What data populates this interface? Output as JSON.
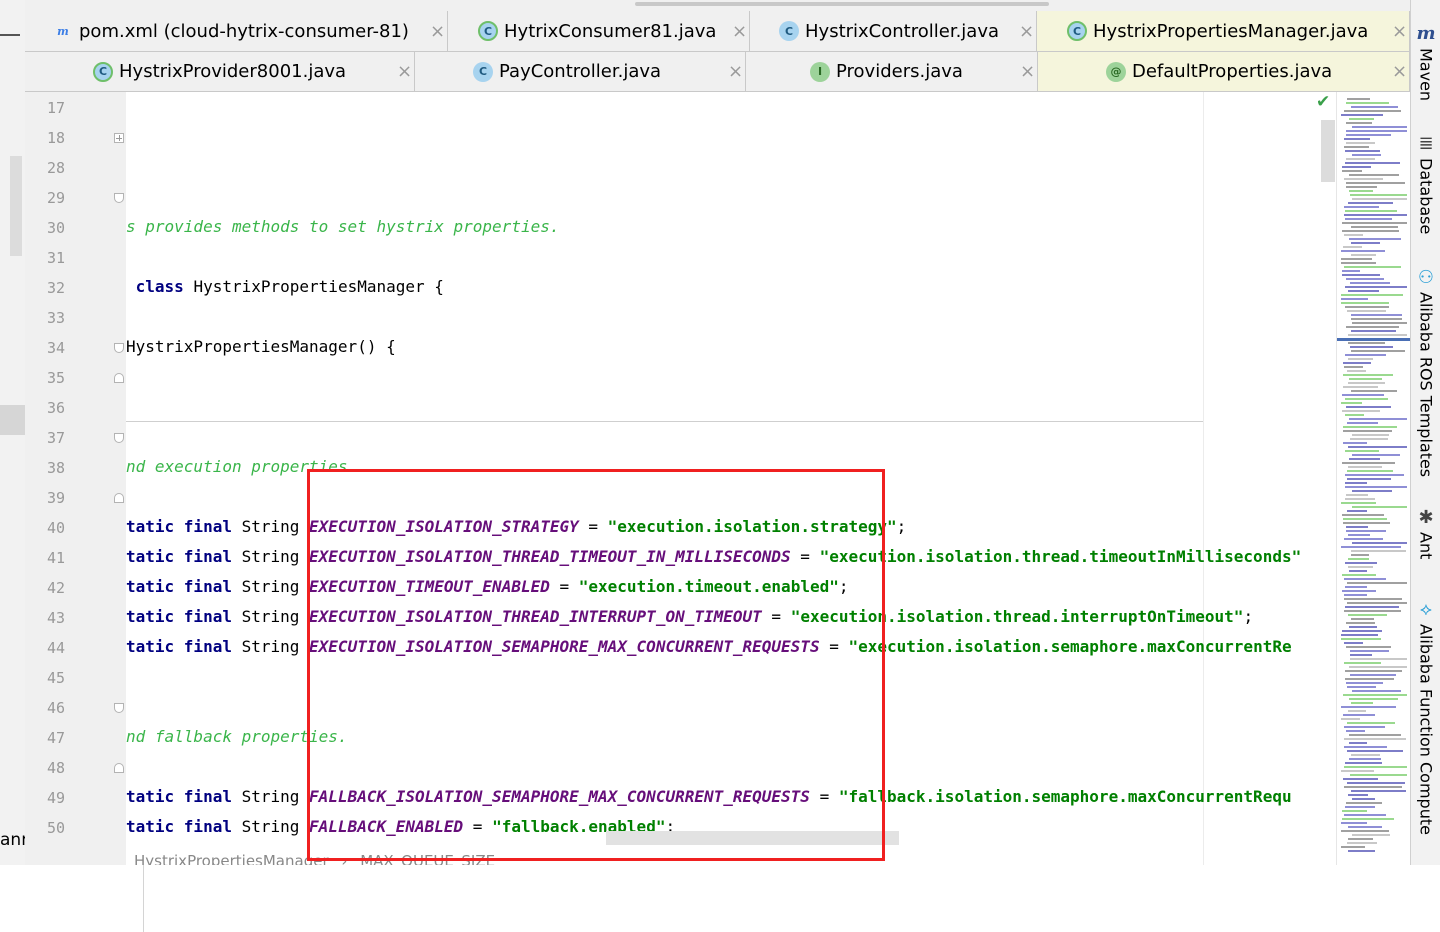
{
  "left_panel": {
    "bottom_text": "anr"
  },
  "tabs_row1": [
    {
      "label": "pom.xml (cloud-hytrix-consumer-81)",
      "icon": "maven-icon",
      "icon_glyph": "m",
      "active": false
    },
    {
      "label": "HytrixConsumer81.java",
      "icon": "spring-class-icon",
      "icon_glyph": "C",
      "active": false
    },
    {
      "label": "HystrixController.java",
      "icon": "class-icon",
      "icon_glyph": "C",
      "active": false
    },
    {
      "label": "HystrixPropertiesManager.java",
      "icon": "spring-class-icon",
      "icon_glyph": "C",
      "active": true
    }
  ],
  "tabs_row2": [
    {
      "label": "HystrixProvider8001.java",
      "icon": "spring-class-icon",
      "icon_glyph": "C",
      "active": false
    },
    {
      "label": "PayController.java",
      "icon": "class-icon",
      "icon_glyph": "C",
      "active": false
    },
    {
      "label": "Providers.java",
      "icon": "interface-icon",
      "icon_glyph": "I",
      "active": false
    },
    {
      "label": "DefaultProperties.java",
      "icon": "annotation-icon",
      "icon_glyph": "@",
      "active": true
    }
  ],
  "close_glyph": "×",
  "line_numbers": [
    "17",
    "18",
    "28",
    "29",
    "30",
    "31",
    "32",
    "33",
    "34",
    "35",
    "36",
    "37",
    "38",
    "39",
    "40",
    "41",
    "42",
    "43",
    "44",
    "45",
    "46",
    "47",
    "48",
    "49",
    "50"
  ],
  "code_lines": [
    {
      "line": "17",
      "tokens": []
    },
    {
      "line": "18",
      "tokens": []
    },
    {
      "line": "28",
      "tokens": []
    },
    {
      "line": "29",
      "tokens": []
    },
    {
      "line": "30",
      "tokens": [
        {
          "t": "s provides methods to set hystrix properties.",
          "c": "comment"
        }
      ]
    },
    {
      "line": "31",
      "tokens": []
    },
    {
      "line": "32",
      "tokens": [
        {
          "t": " ",
          "c": "plain"
        },
        {
          "t": "class",
          "c": "kw"
        },
        {
          "t": " HystrixPropertiesManager {",
          "c": "plain"
        }
      ]
    },
    {
      "line": "33",
      "tokens": []
    },
    {
      "line": "34",
      "tokens": [
        {
          "t": "HystrixPropertiesManager() {",
          "c": "plain"
        }
      ]
    },
    {
      "line": "35",
      "tokens": []
    },
    {
      "line": "36",
      "tokens": []
    },
    {
      "line": "37",
      "tokens": []
    },
    {
      "line": "38",
      "tokens": [
        {
          "t": "nd execution properties.",
          "c": "comment"
        }
      ]
    },
    {
      "line": "39",
      "tokens": []
    },
    {
      "line": "40",
      "tokens": [
        {
          "t": "tatic final",
          "c": "kw"
        },
        {
          "t": " String ",
          "c": "plain"
        },
        {
          "t": "EXECUTION_ISOLATION_STRATEGY",
          "c": "const"
        },
        {
          "t": " = ",
          "c": "plain"
        },
        {
          "t": "\"execution.isolation.strategy\"",
          "c": "str"
        },
        {
          "t": ";",
          "c": "plain"
        }
      ]
    },
    {
      "line": "41",
      "tokens": [
        {
          "t": "tatic final",
          "c": "kw"
        },
        {
          "t": " String ",
          "c": "plain"
        },
        {
          "t": "EXECUTION_ISOLATION_THREAD_TIMEOUT_IN_MILLISECONDS",
          "c": "const"
        },
        {
          "t": " = ",
          "c": "plain"
        },
        {
          "t": "\"execution.isolation.thread.timeoutInMilliseconds\"",
          "c": "str"
        }
      ]
    },
    {
      "line": "42",
      "tokens": [
        {
          "t": "tatic final",
          "c": "kw"
        },
        {
          "t": " String ",
          "c": "plain"
        },
        {
          "t": "EXECUTION_TIMEOUT_ENABLED",
          "c": "const"
        },
        {
          "t": " = ",
          "c": "plain"
        },
        {
          "t": "\"execution.timeout.enabled\"",
          "c": "str"
        },
        {
          "t": ";",
          "c": "plain"
        }
      ]
    },
    {
      "line": "43",
      "tokens": [
        {
          "t": "tatic final",
          "c": "kw"
        },
        {
          "t": " String ",
          "c": "plain"
        },
        {
          "t": "EXECUTION_ISOLATION_THREAD_INTERRUPT_ON_TIMEOUT",
          "c": "const"
        },
        {
          "t": " = ",
          "c": "plain"
        },
        {
          "t": "\"execution.isolation.thread.interruptOnTimeout\"",
          "c": "str"
        },
        {
          "t": ";",
          "c": "plain"
        }
      ]
    },
    {
      "line": "44",
      "tokens": [
        {
          "t": "tatic final",
          "c": "kw"
        },
        {
          "t": " String ",
          "c": "plain"
        },
        {
          "t": "EXECUTION_ISOLATION_SEMAPHORE_MAX_CONCURRENT_REQUESTS",
          "c": "const"
        },
        {
          "t": " = ",
          "c": "plain"
        },
        {
          "t": "\"execution.isolation.semaphore.maxConcurrentRe",
          "c": "str"
        }
      ]
    },
    {
      "line": "45",
      "tokens": []
    },
    {
      "line": "46",
      "tokens": []
    },
    {
      "line": "47",
      "tokens": [
        {
          "t": "nd fallback properties.",
          "c": "comment"
        }
      ]
    },
    {
      "line": "48",
      "tokens": []
    },
    {
      "line": "49",
      "tokens": [
        {
          "t": "tatic final",
          "c": "kw"
        },
        {
          "t": " String ",
          "c": "plain"
        },
        {
          "t": "FALLBACK_ISOLATION_SEMAPHORE_MAX_CONCURRENT_REQUESTS",
          "c": "const"
        },
        {
          "t": " = ",
          "c": "plain"
        },
        {
          "t": "\"fallback.isolation.semaphore.maxConcurrentRequ",
          "c": "str"
        }
      ]
    },
    {
      "line": "50",
      "tokens": [
        {
          "t": "tatic final",
          "c": "kw"
        },
        {
          "t": " String ",
          "c": "plain"
        },
        {
          "t": "FALLBACK_ENABLED",
          "c": "const"
        },
        {
          "t": " = ",
          "c": "plain"
        },
        {
          "t": "\"fallback.enabled\"",
          "c": "str"
        },
        {
          "t": ";",
          "c": "plain"
        }
      ]
    }
  ],
  "breadcrumb": {
    "class_name": "HystrixPropertiesManager",
    "separator": "›",
    "member": "MAX_QUEUE_SIZE"
  },
  "tool_windows": [
    {
      "label": "Maven",
      "icon": "maven-icon",
      "glyph": "m"
    },
    {
      "label": "Database",
      "icon": "database-icon",
      "glyph": "≣"
    },
    {
      "label": "Alibaba ROS Templates",
      "icon": "ros-icon",
      "glyph": "⚇"
    },
    {
      "label": "Ant",
      "icon": "ant-icon",
      "glyph": "✱"
    },
    {
      "label": "Alibaba Function Compute",
      "icon": "function-compute-icon",
      "glyph": "⟡"
    }
  ],
  "inspection_status": "✔",
  "colors": {
    "highlight_box": "#f02020",
    "comment": "#3ab54a",
    "keyword": "#000080",
    "constant": "#660e7a",
    "string": "#008000",
    "active_tab": "#f5f5dc"
  }
}
